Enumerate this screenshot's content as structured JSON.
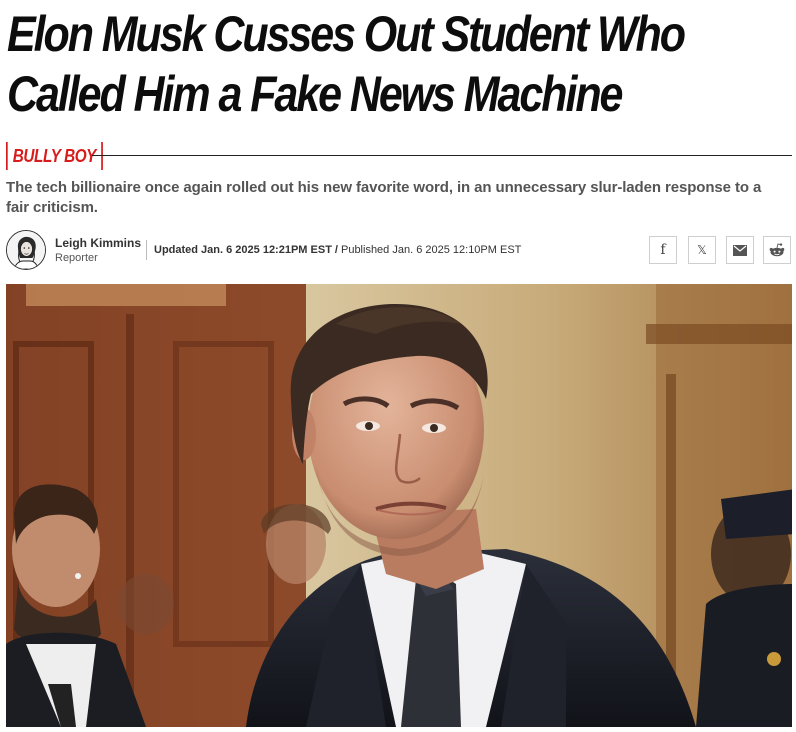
{
  "article": {
    "headline": "Elon Musk Cusses Out Student Who Called Him a Fake News Machine",
    "rubric": "BULLY BOY",
    "dek": "The tech billionaire once again rolled out his new favorite word, in an unnecessary slur-laden response to a fair criticism.",
    "author": {
      "name": "Leigh Kimmins",
      "role": "Reporter"
    },
    "updated": "Updated Jan. 6 2025 12:21PM EST",
    "separator": "/",
    "published": "Published Jan. 6 2025 12:10PM EST"
  },
  "share": {
    "icons": [
      "facebook-icon",
      "x-icon",
      "email-icon",
      "reddit-icon"
    ],
    "facebook_glyph": "f",
    "x_glyph": "𝕏"
  },
  "colors": {
    "accent": "#d81b1b",
    "headline": "#0d0d0d",
    "dek": "#555555"
  }
}
